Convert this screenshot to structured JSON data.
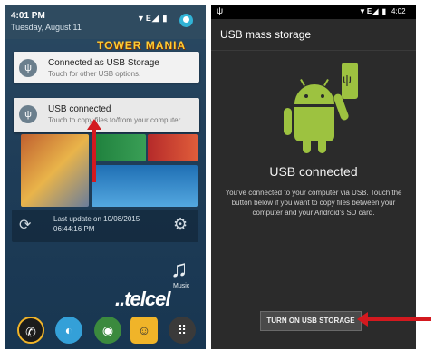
{
  "left_screen": {
    "status": {
      "time": "4:01 PM",
      "date": "Tuesday, August 11",
      "icons": "▼E◢ ▮"
    },
    "notifications": [
      {
        "title": "Connected as USB Storage",
        "subtitle": "Touch for other USB options."
      },
      {
        "title": "USB connected",
        "subtitle": "Touch to copy files to/from your computer."
      }
    ],
    "widget_text": "TOWER MANIA",
    "update": {
      "line1": "Last update on 10/08/2015",
      "line2": "06:44:16 PM"
    },
    "music_label": "Music",
    "carrier_logo": "..telcel",
    "colors": {
      "status_bg": "#2f4b60",
      "accent": "#31b3d6",
      "arrow": "#d3191f"
    },
    "icons": {
      "usb": "usb-icon",
      "refresh": "refresh-icon",
      "gear": "gear-icon",
      "music": "music-note-icon",
      "phone": "phone-icon",
      "browser": "browser-icon",
      "chrome": "chrome-icon",
      "messages": "messages-icon",
      "apps": "apps-icon"
    }
  },
  "right_screen": {
    "status": {
      "usb": "ψ",
      "icons": "▼E◢ ▮",
      "time": "4:02"
    },
    "title": "USB mass storage",
    "headline": "USB connected",
    "body": "You've connected to your computer via USB. Touch the button below if you want to copy files between your computer and your Android's SD card.",
    "button": "TURN ON USB STORAGE",
    "colors": {
      "android_green": "#9dc240",
      "background": "#2b2b2b",
      "arrow": "#d3191f"
    }
  }
}
